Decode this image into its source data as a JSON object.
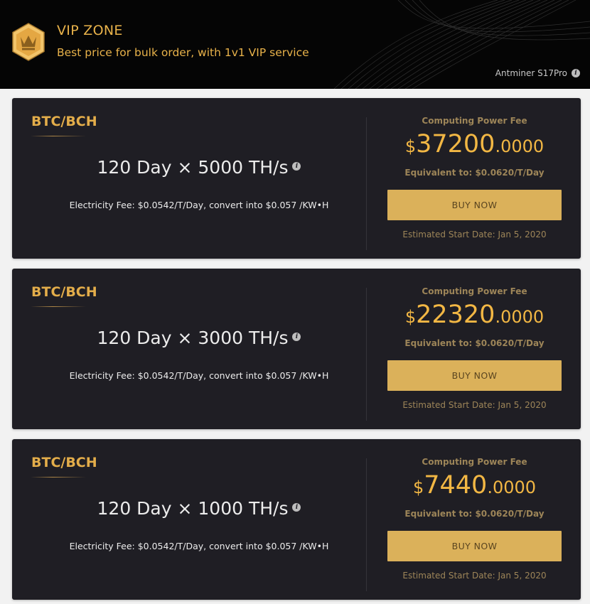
{
  "header": {
    "title": "VIP ZONE",
    "subtitle": "Best price for bulk order, with 1v1 VIP service",
    "model": "Antminer S17Pro",
    "badge_icon": "crown-icon",
    "info_icon": "info-icon"
  },
  "colors": {
    "accent": "#e3ad4a",
    "price": "#f2b744",
    "button": "#dbb15a",
    "card_bg": "#1f1e24",
    "header_bg": "#050505"
  },
  "cards": [
    {
      "label": "BTC/BCH",
      "plan": "120 Day × 5000 TH/s",
      "electricity": "Electricity Fee: $0.0542/T/Day, convert into $0.057 /KW•H",
      "fee_label": "Computing Power Fee",
      "currency": "$",
      "price_int": "37200",
      "price_dec": ".0000",
      "equivalent": "Equivalent to: $0.0620/T/Day",
      "button": "BUY NOW",
      "start_date": "Estimated Start Date: Jan 5, 2020"
    },
    {
      "label": "BTC/BCH",
      "plan": "120 Day × 3000 TH/s",
      "electricity": "Electricity Fee: $0.0542/T/Day, convert into $0.057 /KW•H",
      "fee_label": "Computing Power Fee",
      "currency": "$",
      "price_int": "22320",
      "price_dec": ".0000",
      "equivalent": "Equivalent to: $0.0620/T/Day",
      "button": "BUY NOW",
      "start_date": "Estimated Start Date: Jan 5, 2020"
    },
    {
      "label": "BTC/BCH",
      "plan": "120 Day × 1000 TH/s",
      "electricity": "Electricity Fee: $0.0542/T/Day, convert into $0.057 /KW•H",
      "fee_label": "Computing Power Fee",
      "currency": "$",
      "price_int": "7440",
      "price_dec": ".0000",
      "equivalent": "Equivalent to: $0.0620/T/Day",
      "button": "BUY NOW",
      "start_date": "Estimated Start Date: Jan 5, 2020"
    }
  ]
}
